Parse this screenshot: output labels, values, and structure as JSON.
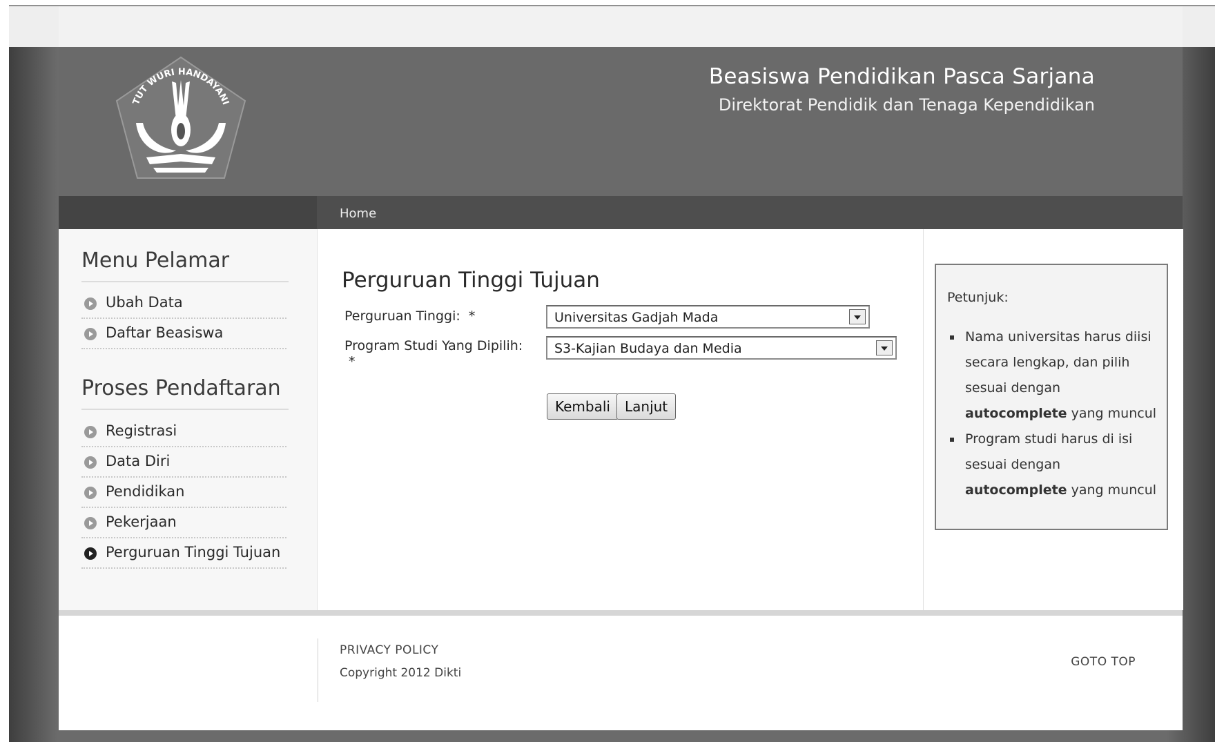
{
  "header": {
    "title": "Beasiswa Pendidikan Pasca Sarjana",
    "subtitle": "Direktorat Pendidik dan Tenaga Kependidikan",
    "logo_text": "TUT WURI HANDAYANI"
  },
  "nav": {
    "home": "Home"
  },
  "sidebar": {
    "menu_heading": "Menu Pelamar",
    "menu_items": [
      {
        "label": "Ubah Data"
      },
      {
        "label": "Daftar Beasiswa"
      }
    ],
    "process_heading": "Proses Pendaftaran",
    "process_items": [
      {
        "label": "Registrasi"
      },
      {
        "label": "Data Diri"
      },
      {
        "label": "Pendidikan"
      },
      {
        "label": "Pekerjaan"
      },
      {
        "label": "Perguruan Tinggi Tujuan",
        "active": true
      }
    ]
  },
  "main": {
    "title": "Perguruan Tinggi Tujuan",
    "fields": [
      {
        "label": "Perguruan Tinggi:",
        "required": "*",
        "value": "Universitas Gadjah Mada"
      },
      {
        "label": "Program Studi Yang Dipilih:",
        "required": "*",
        "value": "S3-Kajian Budaya dan Media"
      }
    ],
    "back_button": "Kembali",
    "next_button": "Lanjut"
  },
  "help": {
    "title": "Petunjuk:",
    "items": [
      {
        "before": "Nama universitas harus diisi secara lengkap, dan pilih sesuai dengan",
        "bold": "autocomplete",
        "after": "yang muncul"
      },
      {
        "before": "Program studi harus di isi sesuai dengan",
        "bold": "autocomplete",
        "after": "yang muncul"
      }
    ]
  },
  "footer": {
    "privacy": "PRIVACY POLICY",
    "copyright": "Copyright 2012 Dikti",
    "goto_top": "GOTO TOP"
  }
}
